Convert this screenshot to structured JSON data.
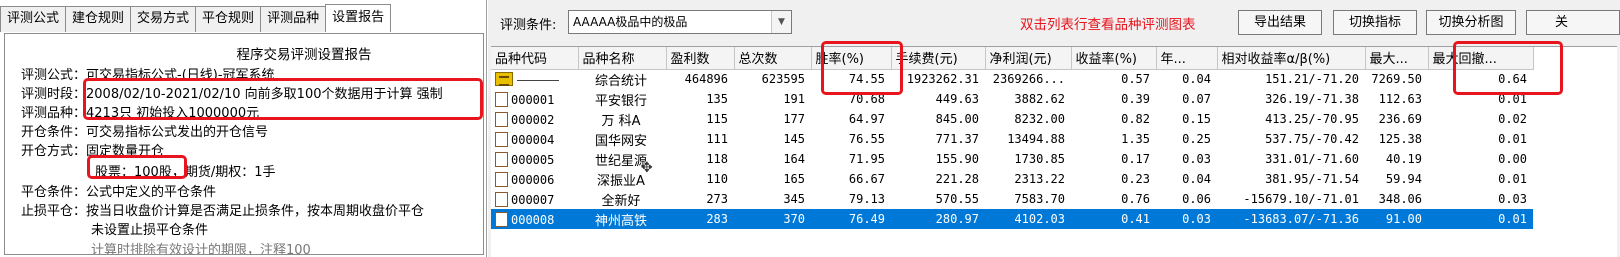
{
  "tabs": [
    "评测公式",
    "建仓规则",
    "交易方式",
    "平仓规则",
    "评测品种",
    "设置报告"
  ],
  "active_tab_index": 5,
  "report": {
    "title": "程序交易评测设置报告",
    "lines": [
      "评测公式：可交易指标公式-(日线)-冠军系统",
      "评测时段：2008/02/10-2021/02/10 向前多取100个数据用于计算 强制",
      "评测品种：4213只 初始投入1000000元",
      "开仓条件：可交易指标公式发出的开仓信号",
      "开仓方式：固定数量开仓",
      "股票：100股，期货/期权：1手",
      "平仓条件：公式中定义的平仓条件",
      "止损平仓：按当日收盘价计算是否满足止损条件，按本周期收盘价平仓",
      "未设置止损平仓条件",
      "计算时排除有效设计的期限，注释100"
    ]
  },
  "toolbar": {
    "condition_label": "评测条件:",
    "condition_value": "AAAAA极品中的极品",
    "hint": "双击列表行查看品种评测图表",
    "export_label": "导出结果",
    "switch_indicator_label": "切换指标",
    "switch_chart_label": "切换分析图",
    "close_label": "关"
  },
  "table": {
    "columns": [
      "品种代码",
      "品种名称",
      "盈利数",
      "总次数",
      "胜率(%)",
      "手续费(元)",
      "净利润(元)",
      "收益率(%)",
      "年...",
      "相对收益率α/β(%)",
      "最大...",
      "最大回撤..."
    ],
    "summary": [
      "",
      "综合统计",
      "464896",
      "623595",
      "74.55",
      "1923262.31",
      "2369266...",
      "0.57",
      "0.04",
      "151.21/-71.20",
      "7269.50",
      "0.64"
    ],
    "rows": [
      [
        "000001",
        "平安银行",
        "135",
        "191",
        "70.68",
        "449.63",
        "3882.62",
        "0.39",
        "0.07",
        "326.19/-71.38",
        "112.63",
        "0.01"
      ],
      [
        "000002",
        "万 科A",
        "115",
        "177",
        "64.97",
        "845.00",
        "8232.00",
        "0.82",
        "0.15",
        "413.25/-70.95",
        "236.69",
        "0.02"
      ],
      [
        "000004",
        "国华网安",
        "111",
        "145",
        "76.55",
        "771.37",
        "13494.88",
        "1.35",
        "0.25",
        "537.75/-70.42",
        "125.38",
        "0.01"
      ],
      [
        "000005",
        "世纪星源",
        "118",
        "164",
        "71.95",
        "155.90",
        "1730.85",
        "0.17",
        "0.03",
        "331.01/-71.60",
        "40.19",
        "0.00"
      ],
      [
        "000006",
        "深振业A",
        "110",
        "165",
        "66.67",
        "221.28",
        "2313.22",
        "0.23",
        "0.04",
        "381.95/-71.54",
        "59.94",
        "0.01"
      ],
      [
        "000007",
        "全新好",
        "273",
        "345",
        "79.13",
        "570.55",
        "7583.70",
        "0.76",
        "0.06",
        "-15679.10/-71.01",
        "348.06",
        "0.03"
      ],
      [
        "000008",
        "神州高铁",
        "283",
        "370",
        "76.49",
        "280.97",
        "4102.03",
        "0.41",
        "0.03",
        "-13683.07/-71.36",
        "91.00",
        "0.01"
      ]
    ],
    "selected_row_index": 6
  },
  "colors": {
    "highlight_box": "#e8141e",
    "selection": "#0078d7",
    "hint_text": "#e8141e"
  },
  "icons": {
    "summary_row": "summary-icon",
    "stock_row": "document-icon",
    "cursor": "move-cursor-icon"
  }
}
